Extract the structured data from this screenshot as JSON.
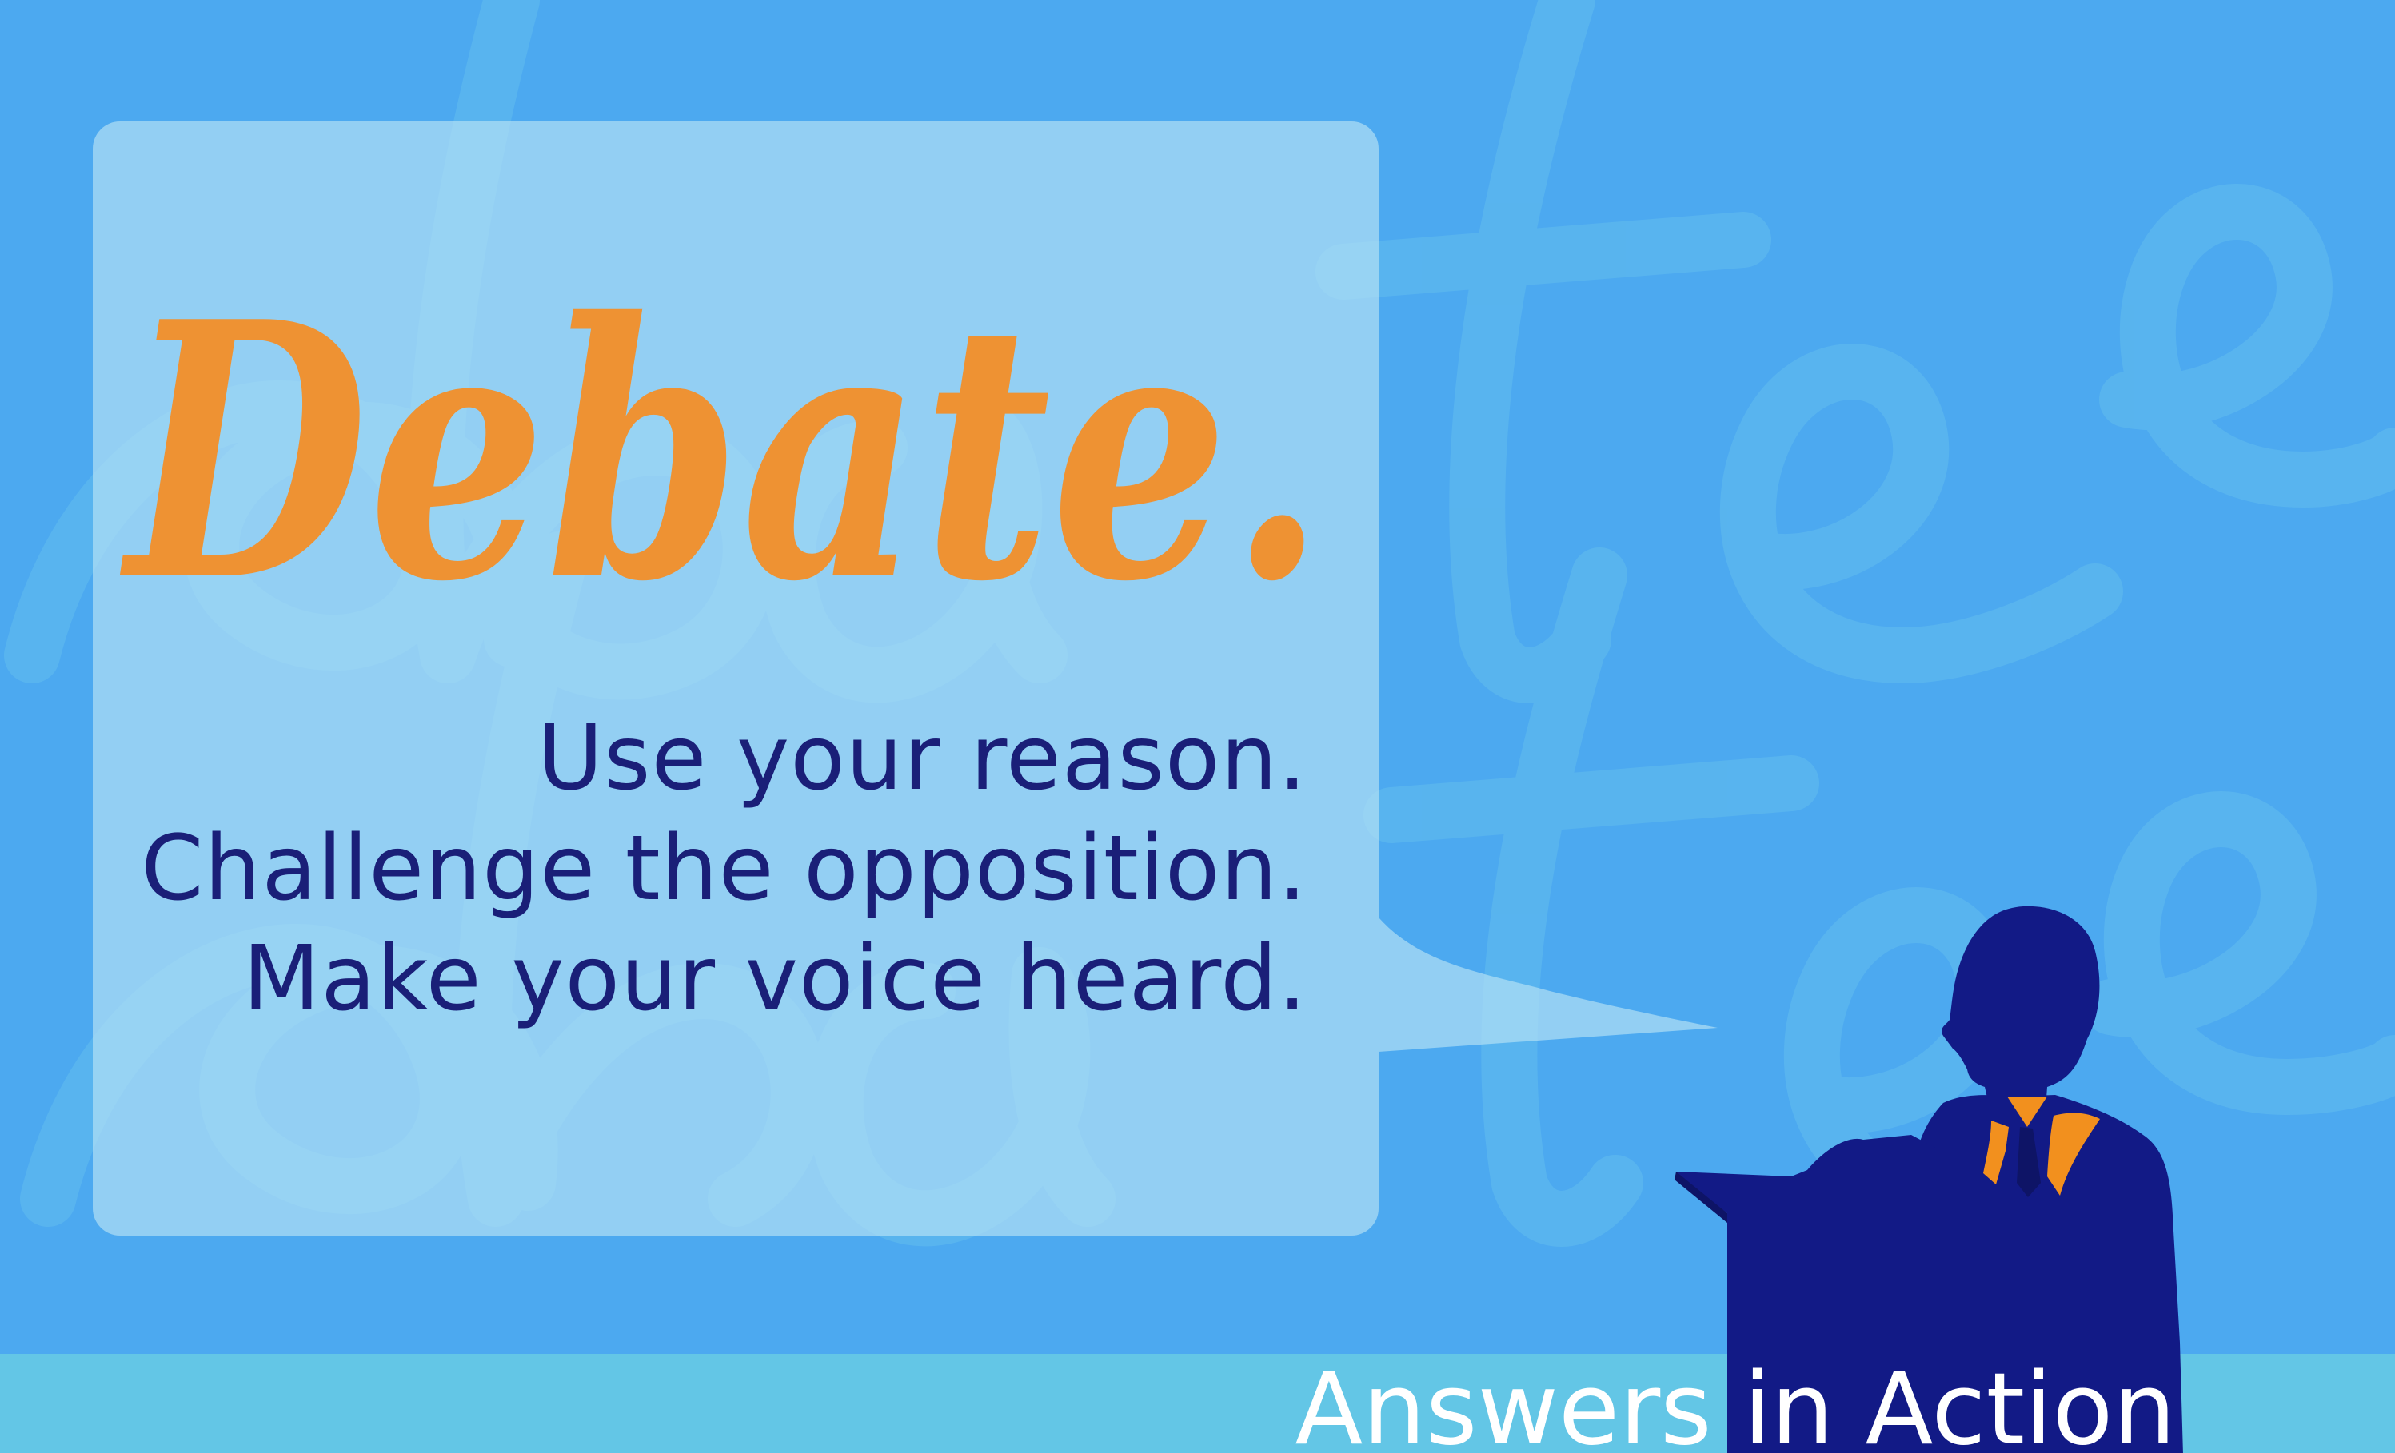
{
  "title": "Debate.",
  "taglines": [
    "Use your reason.",
    "Challenge the opposition.",
    "Make your voice heard."
  ],
  "brand": "Answers in Action",
  "colors": {
    "background": "#4ca9f0",
    "title": "#ee9233",
    "tagline": "#1a1f78",
    "footer": "#63c6e6",
    "silhouette": "#121a86",
    "tie": "#f2901e"
  }
}
